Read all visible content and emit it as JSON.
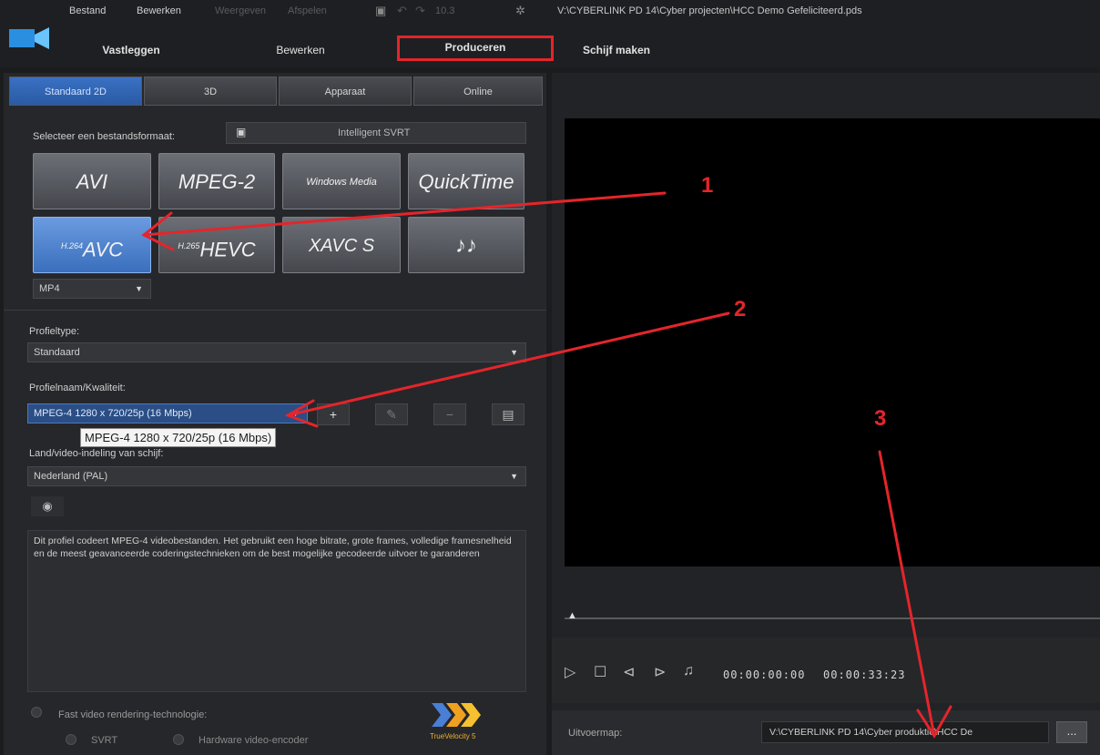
{
  "menu": {
    "bestand": "Bestand",
    "bewerken": "Bewerken",
    "weergeven": "Weergeven",
    "afspelen": "Afspelen",
    "zoom": "10.3"
  },
  "title_path": "V:\\CYBERLINK PD 14\\Cyber projecten\\HCC Demo Gefeliciteerd.pds",
  "main_tabs": [
    "Vastleggen",
    "Bewerken",
    "Produceren",
    "Schijf maken"
  ],
  "sub_tabs": [
    "Standaard 2D",
    "3D",
    "Apparaat",
    "Online"
  ],
  "file_format": {
    "label": "Selecteer een bestandsformaat:",
    "svrt": "Intelligent SVRT"
  },
  "formats": [
    {
      "label": "AVI",
      "sup": ""
    },
    {
      "label": "MPEG-2",
      "sup": ""
    },
    {
      "label": "Windows Media",
      "sup": ""
    },
    {
      "label": "QuickTime",
      "sup": ""
    },
    {
      "label": "AVC",
      "sup": "H.264"
    },
    {
      "label": "HEVC",
      "sup": "H.265"
    },
    {
      "label": "XAVC S",
      "sup": ""
    },
    {
      "label": "♪♪",
      "sup": ""
    }
  ],
  "container": "MP4",
  "profile_type": {
    "label": "Profieltype:",
    "value": "Standaard"
  },
  "profile_name": {
    "label": "Profielnaam/Kwaliteit:",
    "value": "MPEG-4 1280 x 720/25p (16 Mbps)"
  },
  "tooltip": "MPEG-4 1280 x 720/25p (16 Mbps)",
  "disc": {
    "label": "Land/video-indeling van schijf:",
    "value": "Nederland (PAL)"
  },
  "description": "Dit profiel codeert MPEG-4 videobestanden. Het gebruikt een hoge bitrate, grote frames, volledige framesnelheid en de meest geavanceerde coderingstechnieken om de best mogelijke gecodeerde uitvoer te garanderen",
  "fast_video": {
    "label": "Fast video rendering-technologie:",
    "svrt": "SVRT",
    "hw": "Hardware video-encoder",
    "logo_text": "TrueVelocity 5"
  },
  "timecode_current": "00:00:00:00",
  "timecode_total": "00:00:33:23",
  "output": {
    "label": "Uitvoermap:",
    "path": "V:\\CYBERLINK PD 14\\Cyber produktie\\HCC De",
    "browse": "..."
  },
  "annotations": [
    "1",
    "2",
    "3"
  ],
  "colors": {
    "highlight": "#e4252b",
    "selected_format": "#3a6fbd"
  }
}
